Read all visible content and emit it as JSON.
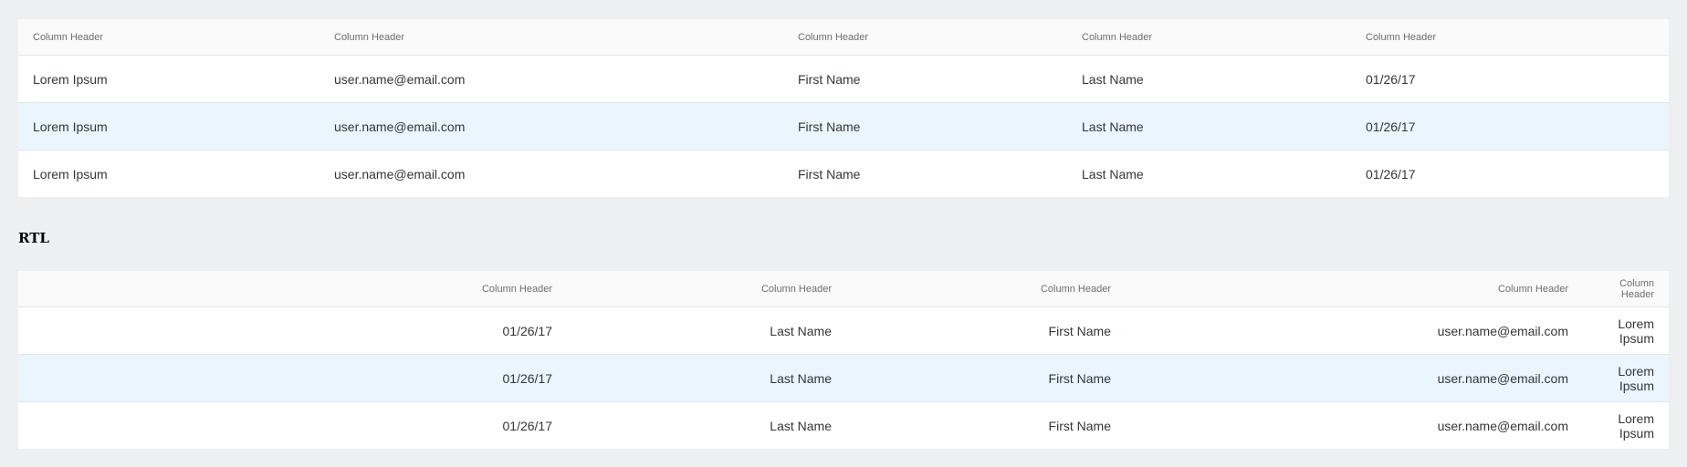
{
  "ltr_table": {
    "headers": [
      "Column Header",
      "Column Header",
      "Column Header",
      "Column Header",
      "Column Header"
    ],
    "rows": [
      [
        "Lorem Ipsum",
        "user.name@email.com",
        "First Name",
        "Last Name",
        "01/26/17"
      ],
      [
        "Lorem Ipsum",
        "user.name@email.com",
        "First Name",
        "Last Name",
        "01/26/17"
      ],
      [
        "Lorem Ipsum",
        "user.name@email.com",
        "First Name",
        "Last Name",
        "01/26/17"
      ]
    ],
    "selected_row": 2
  },
  "rtl_section": {
    "label": "RTL"
  },
  "rtl_table": {
    "headers": [
      "Column Header",
      "Column Header",
      "Column Header",
      "Column Header",
      "Column Header"
    ],
    "rows": [
      [
        "Lorem Ipsum",
        "user.name@email.com",
        "First Name",
        "Last Name",
        "01/26/17"
      ],
      [
        "Lorem Ipsum",
        "user.name@email.com",
        "First Name",
        "Last Name",
        "01/26/17"
      ],
      [
        "Lorem Ipsum",
        "user.name@email.com",
        "First Name",
        "Last Name",
        "01/26/17"
      ]
    ],
    "selected_row": 2
  },
  "colors": {
    "page_background": "#edeff0",
    "header_background": "#fafafa",
    "selected_row_background": "#ebf5fe",
    "row_background": "#ffffff"
  }
}
